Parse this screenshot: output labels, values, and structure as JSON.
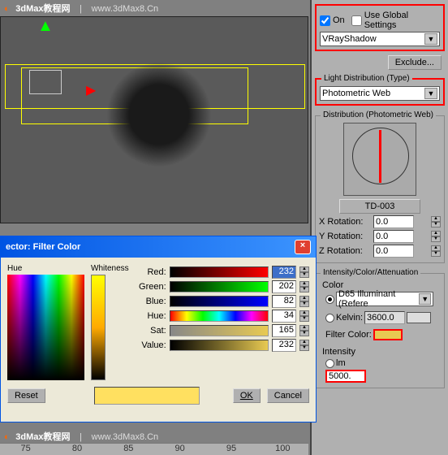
{
  "watermark": {
    "brand": "3dMax教程网",
    "sep": "|",
    "url": "www.3dMax8.Cn"
  },
  "shadow_panel": {
    "on_label": "On",
    "global_label": "Use Global Settings",
    "type_value": "VRayShadow",
    "exclude_btn": "Exclude..."
  },
  "light_dist": {
    "title": "Light Distribution (Type)",
    "value": "Photometric Web"
  },
  "dist_web": {
    "title": "Distribution (Photometric Web)",
    "file_btn": "TD-003",
    "x_label": "X Rotation:",
    "x_val": "0.0",
    "y_label": "Y Rotation:",
    "y_val": "0.0",
    "z_label": "Z Rotation:",
    "z_val": "0.0"
  },
  "intensity_panel": {
    "title": "Intensity/Color/Attenuation",
    "color_label": "Color",
    "d65_label": "D65 Illuminant (Refere",
    "kelvin_label": "Kelvin:",
    "kelvin_val": "3600.0",
    "filter_label": "Filter Color:",
    "intensity_label": "Intensity",
    "lm_label": "lm",
    "lm_val": "5000."
  },
  "color_dialog": {
    "title": "ector: Filter Color",
    "hue_lbl": "Hue",
    "white_lbl": "Whiteness",
    "red_lbl": "Red:",
    "red_val": "232",
    "green_lbl": "Green:",
    "green_val": "202",
    "blue_lbl": "Blue:",
    "blue_val": "82",
    "hue2_lbl": "Hue:",
    "hue_val": "34",
    "sat_lbl": "Sat:",
    "sat_val": "165",
    "value_lbl": "Value:",
    "value_val": "232",
    "reset_btn": "Reset",
    "ok_btn": "OK",
    "cancel_btn": "Cancel"
  },
  "timeline": {
    "t1": "75",
    "t2": "80",
    "t3": "85",
    "t4": "90",
    "t5": "95",
    "t6": "100"
  }
}
